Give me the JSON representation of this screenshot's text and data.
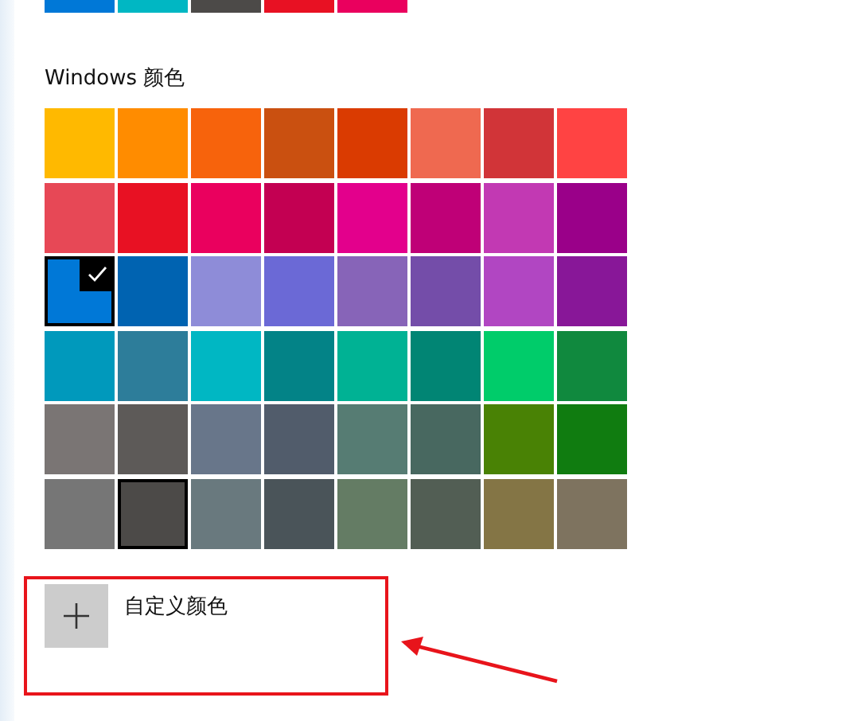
{
  "recent_colors": [
    {
      "color": "#0078d7"
    },
    {
      "color": "#00b7c3"
    },
    {
      "color": "#4c4a48"
    },
    {
      "color": "#e81123"
    },
    {
      "color": "#ea005e"
    }
  ],
  "windows_colors": {
    "heading": "Windows 颜色",
    "swatches": [
      {
        "color": "#ffb900",
        "selected": false,
        "hovered": false
      },
      {
        "color": "#ff8c00",
        "selected": false,
        "hovered": false
      },
      {
        "color": "#f7630c",
        "selected": false,
        "hovered": false
      },
      {
        "color": "#ca5010",
        "selected": false,
        "hovered": false
      },
      {
        "color": "#da3b01",
        "selected": false,
        "hovered": false
      },
      {
        "color": "#ef6950",
        "selected": false,
        "hovered": false
      },
      {
        "color": "#d13438",
        "selected": false,
        "hovered": false
      },
      {
        "color": "#ff4343",
        "selected": false,
        "hovered": false
      },
      {
        "color": "#e74856",
        "selected": false,
        "hovered": false
      },
      {
        "color": "#e81123",
        "selected": false,
        "hovered": false
      },
      {
        "color": "#ea005e",
        "selected": false,
        "hovered": false
      },
      {
        "color": "#c30052",
        "selected": false,
        "hovered": false
      },
      {
        "color": "#e3008c",
        "selected": false,
        "hovered": false
      },
      {
        "color": "#bf0077",
        "selected": false,
        "hovered": false
      },
      {
        "color": "#c239b3",
        "selected": false,
        "hovered": false
      },
      {
        "color": "#9a0089",
        "selected": false,
        "hovered": false
      },
      {
        "color": "#0078d7",
        "selected": true,
        "hovered": false
      },
      {
        "color": "#0063b1",
        "selected": false,
        "hovered": false
      },
      {
        "color": "#8e8cd8",
        "selected": false,
        "hovered": false
      },
      {
        "color": "#6b69d6",
        "selected": false,
        "hovered": false
      },
      {
        "color": "#8764b8",
        "selected": false,
        "hovered": false
      },
      {
        "color": "#744da9",
        "selected": false,
        "hovered": false
      },
      {
        "color": "#b146c2",
        "selected": false,
        "hovered": false
      },
      {
        "color": "#881798",
        "selected": false,
        "hovered": false
      },
      {
        "color": "#0099bc",
        "selected": false,
        "hovered": false
      },
      {
        "color": "#2d7d9a",
        "selected": false,
        "hovered": false
      },
      {
        "color": "#00b7c3",
        "selected": false,
        "hovered": false
      },
      {
        "color": "#038387",
        "selected": false,
        "hovered": false
      },
      {
        "color": "#00b294",
        "selected": false,
        "hovered": false
      },
      {
        "color": "#018574",
        "selected": false,
        "hovered": false
      },
      {
        "color": "#00cc6a",
        "selected": false,
        "hovered": false
      },
      {
        "color": "#10893e",
        "selected": false,
        "hovered": false
      },
      {
        "color": "#7a7574",
        "selected": false,
        "hovered": false
      },
      {
        "color": "#5d5a58",
        "selected": false,
        "hovered": false
      },
      {
        "color": "#68768a",
        "selected": false,
        "hovered": false
      },
      {
        "color": "#515c6b",
        "selected": false,
        "hovered": false
      },
      {
        "color": "#567c73",
        "selected": false,
        "hovered": false
      },
      {
        "color": "#486860",
        "selected": false,
        "hovered": false
      },
      {
        "color": "#498205",
        "selected": false,
        "hovered": false
      },
      {
        "color": "#107c10",
        "selected": false,
        "hovered": false
      },
      {
        "color": "#767676",
        "selected": false,
        "hovered": false
      },
      {
        "color": "#4c4a48",
        "selected": false,
        "hovered": true
      },
      {
        "color": "#69797e",
        "selected": false,
        "hovered": false
      },
      {
        "color": "#4a5459",
        "selected": false,
        "hovered": false
      },
      {
        "color": "#647c64",
        "selected": false,
        "hovered": false
      },
      {
        "color": "#525e54",
        "selected": false,
        "hovered": false
      },
      {
        "color": "#847545",
        "selected": false,
        "hovered": false
      },
      {
        "color": "#7e735f",
        "selected": false,
        "hovered": false
      }
    ]
  },
  "custom_color": {
    "label": "自定义颜色"
  }
}
